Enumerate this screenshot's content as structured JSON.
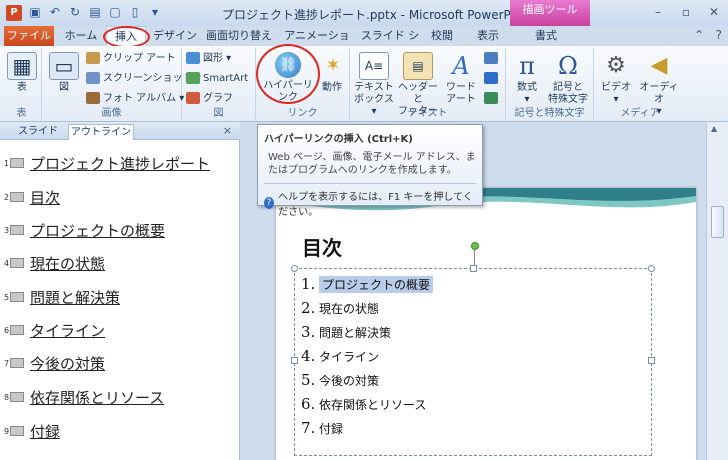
{
  "titlebar": {
    "title": "プロジェクト進捗レポート.pptx - Microsoft PowerPoint",
    "context_tab": "描画ツール",
    "app_icon": "P"
  },
  "tabs": {
    "file": "ファイル",
    "home": "ホーム",
    "insert": "挿入",
    "design": "デザイン",
    "transitions": "画面切り替え",
    "animations": "アニメーション",
    "slideshow": "スライド ショー",
    "review": "校閲",
    "view": "表示",
    "format": "書式"
  },
  "ribbon": {
    "table_btn": "表",
    "image_btn": "図",
    "clipart": "クリップ アート",
    "screenshot": "スクリーンショット",
    "photoalbum": "フォト アルバム",
    "shapes": "図形",
    "smartart": "SmartArt",
    "graph": "グラフ",
    "hyperlink": "ハイパーリンク",
    "action": "動作",
    "textbox": "テキスト\nボックス",
    "textbox1": "テキスト",
    "textbox2": "ボックス",
    "header1": "ヘッダーと",
    "header2": "フッター",
    "wordart": "ワードアート",
    "formula": "数式",
    "symbol1": "記号と",
    "symbol2": "特殊文字",
    "video": "ビデオ",
    "audio": "オーディオ",
    "groups": {
      "table": "表",
      "image": "画像",
      "figure": "図",
      "link": "リンク",
      "text": "テキスト",
      "symbols": "記号と特殊文字",
      "media": "メディア"
    }
  },
  "tooltip": {
    "title": "ハイパーリンクの挿入 (Ctrl+K)",
    "desc": "Web ページ、画像、電子メール アドレス、またはプログラムへのリンクを作成します。",
    "help": "ヘルプを表示するには、F1 キーを押してください。"
  },
  "left_pane": {
    "tab_slides": "スライド",
    "tab_outline": "アウトライン",
    "close": "×",
    "items": [
      {
        "num": "1",
        "text": "プロジェクト進捗レポート"
      },
      {
        "num": "2",
        "text": "目次"
      },
      {
        "num": "3",
        "text": "プロジェクトの概要"
      },
      {
        "num": "4",
        "text": "現在の状態"
      },
      {
        "num": "5",
        "text": "問題と解決策"
      },
      {
        "num": "6",
        "text": "タイライン"
      },
      {
        "num": "7",
        "text": "今後の対策"
      },
      {
        "num": "8",
        "text": "依存関係とリソース"
      },
      {
        "num": "9",
        "text": "付録"
      }
    ]
  },
  "slide": {
    "title": "目次",
    "bullets": [
      {
        "num": "1.",
        "text": "プロジェクトの概要",
        "selected": true
      },
      {
        "num": "2.",
        "text": "現在の状態",
        "selected": false
      },
      {
        "num": "3.",
        "text": "問題と解決策",
        "selected": false
      },
      {
        "num": "4.",
        "text": "タイライン",
        "selected": false
      },
      {
        "num": "5.",
        "text": "今後の対策",
        "selected": false
      },
      {
        "num": "6.",
        "text": "依存関係とリソース",
        "selected": false
      },
      {
        "num": "7.",
        "text": "付録",
        "selected": false
      }
    ]
  },
  "colors": {
    "accent_red": "#e0251e",
    "file_tab": "#d24726",
    "context_tab": "#c9409f",
    "selection": "#b9cdea"
  }
}
